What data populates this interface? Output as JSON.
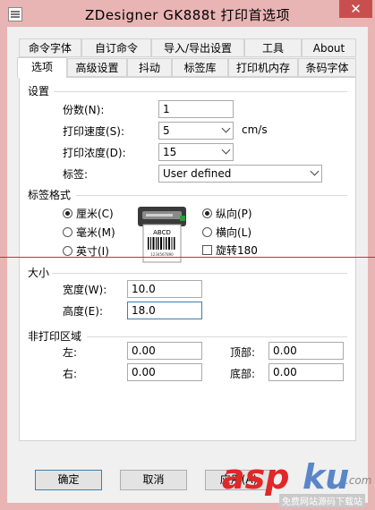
{
  "window": {
    "title": "ZDesigner GK888t 打印首选项",
    "close_glyph": "✕"
  },
  "tabs_row1": [
    {
      "label": "命令字体"
    },
    {
      "label": "自订命令"
    },
    {
      "label": "导入/导出设置"
    },
    {
      "label": "工具"
    },
    {
      "label": "About"
    }
  ],
  "tabs_row2": [
    {
      "label": "选项",
      "active": true
    },
    {
      "label": "高级设置"
    },
    {
      "label": "抖动"
    },
    {
      "label": "标签库"
    },
    {
      "label": "打印机内存"
    },
    {
      "label": "条码字体"
    }
  ],
  "settings": {
    "heading": "设置",
    "copies_label": "份数(N):",
    "copies_value": "1",
    "speed_label": "打印速度(S):",
    "speed_value": "5",
    "speed_unit": "cm/s",
    "darkness_label": "打印浓度(D):",
    "darkness_value": "15",
    "label_label": "标签:",
    "label_value": "User defined"
  },
  "label_format": {
    "heading": "标签格式",
    "units": [
      {
        "label": "厘米(C)",
        "selected": true
      },
      {
        "label": "毫米(M)",
        "selected": false
      },
      {
        "label": "英寸(I)",
        "selected": false
      }
    ],
    "orientation": [
      {
        "label": "纵向(P)",
        "selected": true
      },
      {
        "label": "横向(L)",
        "selected": false
      }
    ],
    "rotate_label": "旋转180",
    "rotate_checked": false,
    "preview_text": "ABCD",
    "preview_number": "1234567890"
  },
  "size": {
    "heading": "大小",
    "width_label": "宽度(W):",
    "width_value": "10.0",
    "height_label": "高度(E):",
    "height_value": "18.0"
  },
  "unprintable": {
    "heading": "非打印区域",
    "left_label": "左:",
    "left_value": "0.00",
    "top_label": "顶部:",
    "top_value": "0.00",
    "right_label": "右:",
    "right_value": "0.00",
    "bottom_label": "底部:",
    "bottom_value": "0.00"
  },
  "buttons": {
    "ok": "确定",
    "cancel": "取消",
    "apply": "应用(A)"
  },
  "watermark": {
    "brand_a": "asp",
    "brand_b": "ku",
    "brand_c": ".com",
    "sub": "免费网站源码下载站"
  }
}
